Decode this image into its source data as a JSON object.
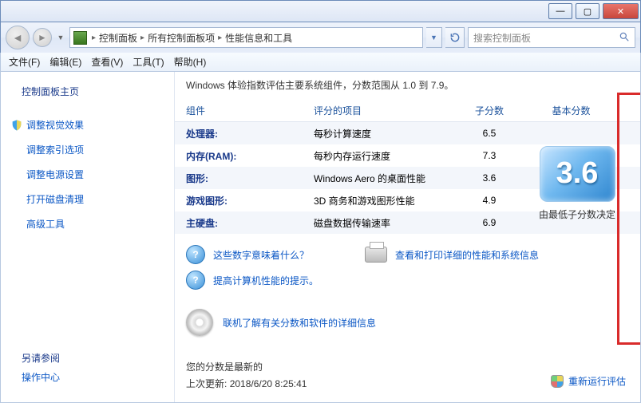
{
  "titlebar": {
    "min": "—",
    "max": "▢",
    "close": "✕"
  },
  "breadcrumb": {
    "seg1": "控制面板",
    "seg2": "所有控制面板项",
    "seg3": "性能信息和工具"
  },
  "search": {
    "placeholder": "搜索控制面板"
  },
  "menu": {
    "file": "文件(F)",
    "edit": "编辑(E)",
    "view": "查看(V)",
    "tools": "工具(T)",
    "help": "帮助(H)"
  },
  "sidebar": {
    "home": "控制面板主页",
    "items": [
      "调整视觉效果",
      "调整索引选项",
      "调整电源设置",
      "打开磁盘清理",
      "高级工具"
    ],
    "seealso_hdr": "另请参阅",
    "seealso_link": "操作中心"
  },
  "intro": "Windows 体验指数评估主要系统组件，分数范围从 1.0 到 7.9。",
  "table": {
    "h1": "组件",
    "h2": "评分的项目",
    "h3": "子分数",
    "h4": "基本分数",
    "rows": [
      {
        "comp": "处理器:",
        "desc": "每秒计算速度",
        "sub": "6.5"
      },
      {
        "comp": "内存(RAM):",
        "desc": "每秒内存运行速度",
        "sub": "7.3"
      },
      {
        "comp": "图形:",
        "desc": "Windows Aero 的桌面性能",
        "sub": "3.6"
      },
      {
        "comp": "游戏图形:",
        "desc": "3D 商务和游戏图形性能",
        "sub": "4.9"
      },
      {
        "comp": "主硬盘:",
        "desc": "磁盘数据传输速率",
        "sub": "6.9"
      }
    ],
    "base_score": "3.6",
    "base_caption": "由最低子分数决定"
  },
  "help_links": {
    "what": "这些数字意味着什么？",
    "view_print": "查看和打印详细的性能和系统信息",
    "tips": "提高计算机性能的提示。",
    "learn": "联机了解有关分数和软件的详细信息"
  },
  "status": {
    "fresh": "您的分数是最新的",
    "updated_prefix": "上次更新:",
    "updated_value": "2018/6/20 8:25:41"
  },
  "reassess": "重新运行评估"
}
